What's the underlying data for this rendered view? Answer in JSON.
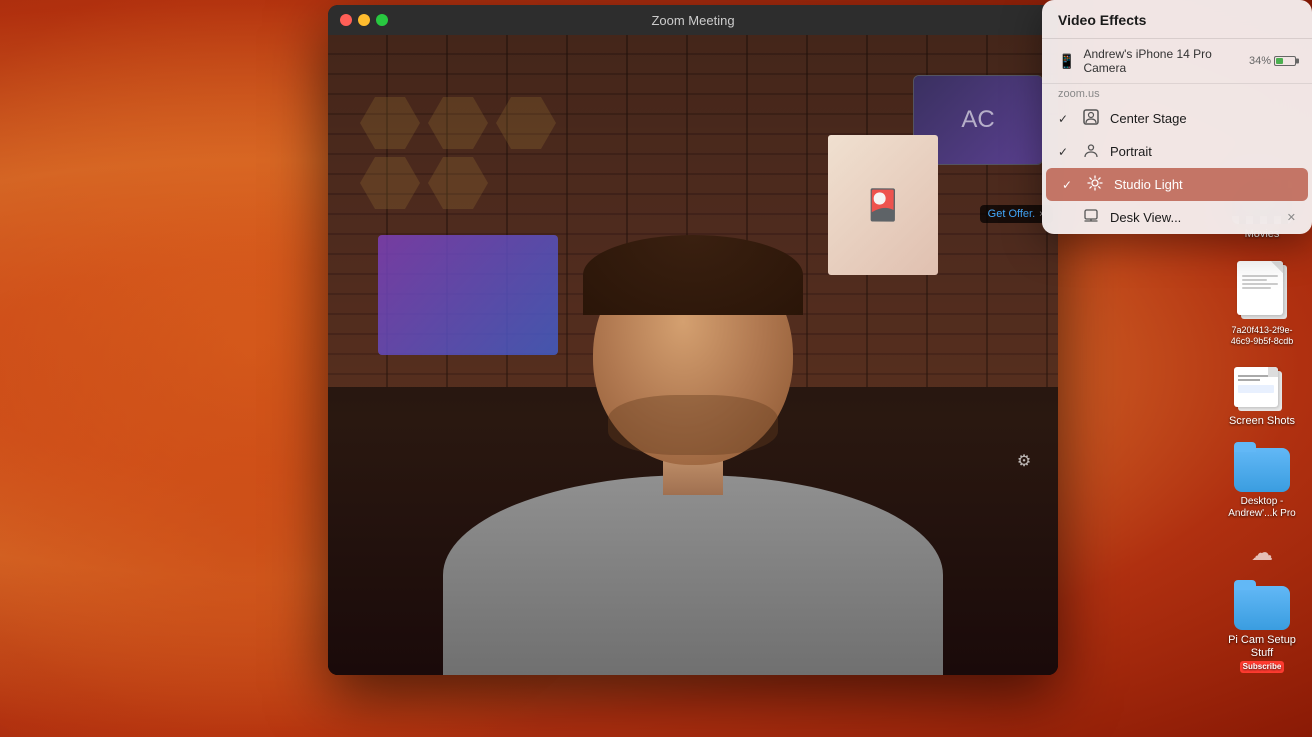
{
  "desktop": {
    "background": "macOS Ventura orange gradient"
  },
  "zoom_window": {
    "title": "Zoom Meeting",
    "controls": {
      "close": "close",
      "minimize": "minimize",
      "maximize": "maximize"
    }
  },
  "video_effects_panel": {
    "title": "Video Effects",
    "device": {
      "name": "Andrew's iPhone 14 Pro Camera",
      "battery": "34%"
    },
    "source": "zoom.us",
    "menu_items": [
      {
        "id": "center-stage",
        "label": "Center Stage",
        "checked": true,
        "icon": "person-frame"
      },
      {
        "id": "portrait",
        "label": "Portrait",
        "checked": true,
        "icon": "person-circle"
      },
      {
        "id": "studio-light",
        "label": "Studio Light",
        "checked": true,
        "icon": "sun",
        "highlighted": true
      },
      {
        "id": "desk-view",
        "label": "Desk View...",
        "checked": false,
        "icon": "monitor",
        "has_close": true
      }
    ]
  },
  "desktop_icons": [
    {
      "id": "movies",
      "label": "Movies",
      "type": "movies"
    },
    {
      "id": "file1",
      "label": "7a20f413-2f9e-46c9-9b5f-8cdb",
      "type": "doc"
    },
    {
      "id": "screenshots",
      "label": "Screen Shots",
      "type": "screenshots"
    },
    {
      "id": "desktop-folder",
      "label": "Desktop - Andrew'...k Pro",
      "type": "folder"
    },
    {
      "id": "cloud",
      "label": "",
      "type": "cloud"
    },
    {
      "id": "pi-cam-setup",
      "label": "Pi Cam Setup Stuff",
      "type": "folder"
    }
  ],
  "get_offer": {
    "label": "Get Offer.",
    "close": "×"
  }
}
